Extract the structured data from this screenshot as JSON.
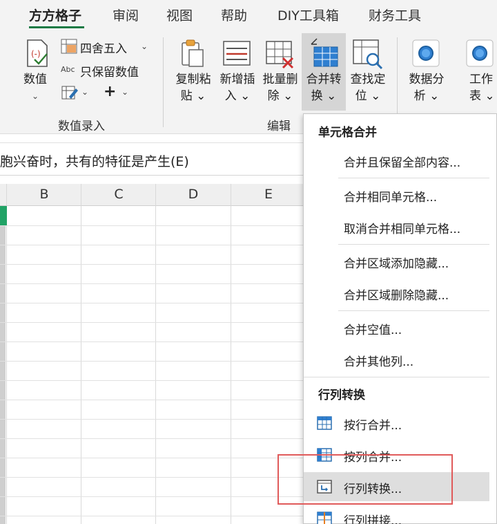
{
  "tabs": [
    {
      "label": "方方格子",
      "active": true
    },
    {
      "label": "审阅"
    },
    {
      "label": "视图"
    },
    {
      "label": "帮助"
    },
    {
      "label": "DIY工具箱"
    },
    {
      "label": "财务工具"
    }
  ],
  "ribbon": {
    "numeric": {
      "label_1": "数值",
      "label_2": "⌄"
    },
    "round": "四舍五入",
    "keep_numeric": "只保留数值",
    "group_numeric_entry": "数值录入",
    "copy_paste": {
      "line1": "复制粘",
      "line2": "贴 ⌄"
    },
    "insert": {
      "line1": "新增插",
      "line2": "入 ⌄"
    },
    "batch_delete": {
      "line1": "批量删",
      "line2": "除 ⌄"
    },
    "merge_convert": {
      "line1": "合并转",
      "line2": "换 ⌄"
    },
    "find_locate": {
      "line1": "查找定",
      "line2": "位 ⌄"
    },
    "group_edit": "编辑",
    "data_analysis": {
      "line1": "数据分",
      "line2": "析 ⌄"
    },
    "worksheet": {
      "line1": "工作",
      "line2": "表 ⌄"
    }
  },
  "formula_bar": {
    "text": "胞兴奋时，共有的特征是产生(E)"
  },
  "sheet": {
    "columns": [
      "B",
      "C",
      "D",
      "E"
    ]
  },
  "menu": {
    "section_1": "单元格合并",
    "items_1": [
      "合并且保留全部内容...",
      "合并相同单元格...",
      "取消合并相同单元格...",
      "合并区域添加隐藏...",
      "合并区域删除隐藏...",
      "合并空值...",
      "合并其他列..."
    ],
    "section_2": "行列转换",
    "items_2": [
      "按行合并...",
      "按列合并...",
      "行列转换...",
      "行列拼接..."
    ]
  },
  "colors": {
    "accent_green": "#1a7a44",
    "excel_green": "#21a366",
    "highlight_box": "#e05a5a"
  }
}
